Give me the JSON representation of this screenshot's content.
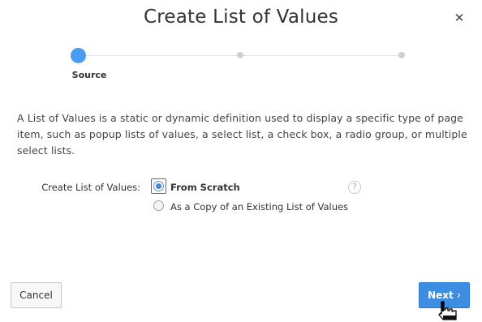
{
  "dialog": {
    "title": "Create List of Values",
    "close_icon": "close-icon",
    "close_glyph": "✕"
  },
  "wizard": {
    "steps": [
      {
        "label": "Source",
        "state": "active"
      },
      {
        "label": "",
        "state": "pending"
      },
      {
        "label": "",
        "state": "pending"
      }
    ],
    "active_color": "#4a9cf0"
  },
  "description": "A List of Values is a static or dynamic definition used to display a specific type of page item, such as popup lists of values, a select list, a check box, a radio group, or multiple select lists.",
  "form": {
    "field_label": "Create List of Values:",
    "options": [
      {
        "label": "From Scratch",
        "selected": true
      },
      {
        "label": "As a Copy of an Existing List of Values",
        "selected": false
      }
    ],
    "help_icon": "help-icon",
    "help_glyph": "?"
  },
  "footer": {
    "cancel_label": "Cancel",
    "next_label": "Next",
    "next_chevron": "›",
    "next_color": "#3d8ee2"
  }
}
